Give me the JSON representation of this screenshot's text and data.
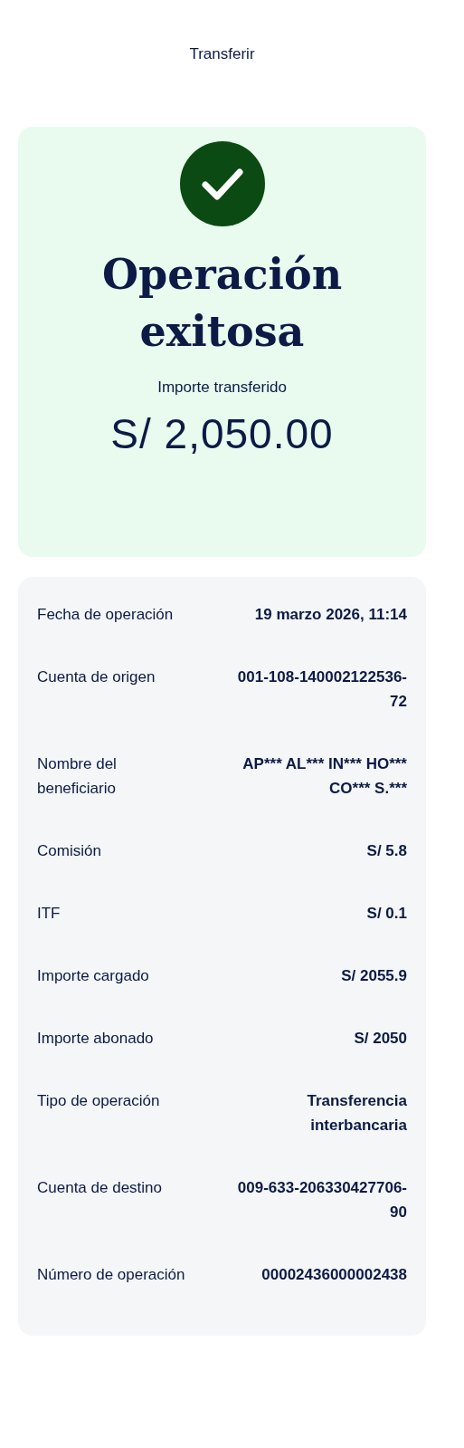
{
  "header": {
    "title": "Transferir"
  },
  "result": {
    "success": true,
    "title": "Operación exitosa",
    "amount_label": "Importe transferido",
    "amount": "S/ 2,050.00"
  },
  "details": [
    {
      "label": "Fecha de operación",
      "value": "19 marzo 2026, 11:14"
    },
    {
      "label": "Cuenta de origen",
      "value": "001-108-140002122536-72"
    },
    {
      "label": "Nombre del beneficiario",
      "value": "AP*** AL*** IN*** HO*** CO*** S.***"
    },
    {
      "label": "Comisión",
      "value": "S/ 5.8"
    },
    {
      "label": "ITF",
      "value": "S/ 0.1"
    },
    {
      "label": "Importe cargado",
      "value": "S/ 2055.9"
    },
    {
      "label": "Importe abonado",
      "value": "S/ 2050"
    },
    {
      "label": "Tipo de operación",
      "value": "Transferencia interbancaria"
    },
    {
      "label": "Cuenta de destino",
      "value": "009-633-206330427706-90"
    },
    {
      "label": "Número de operación",
      "value": "00002436000002438"
    }
  ]
}
